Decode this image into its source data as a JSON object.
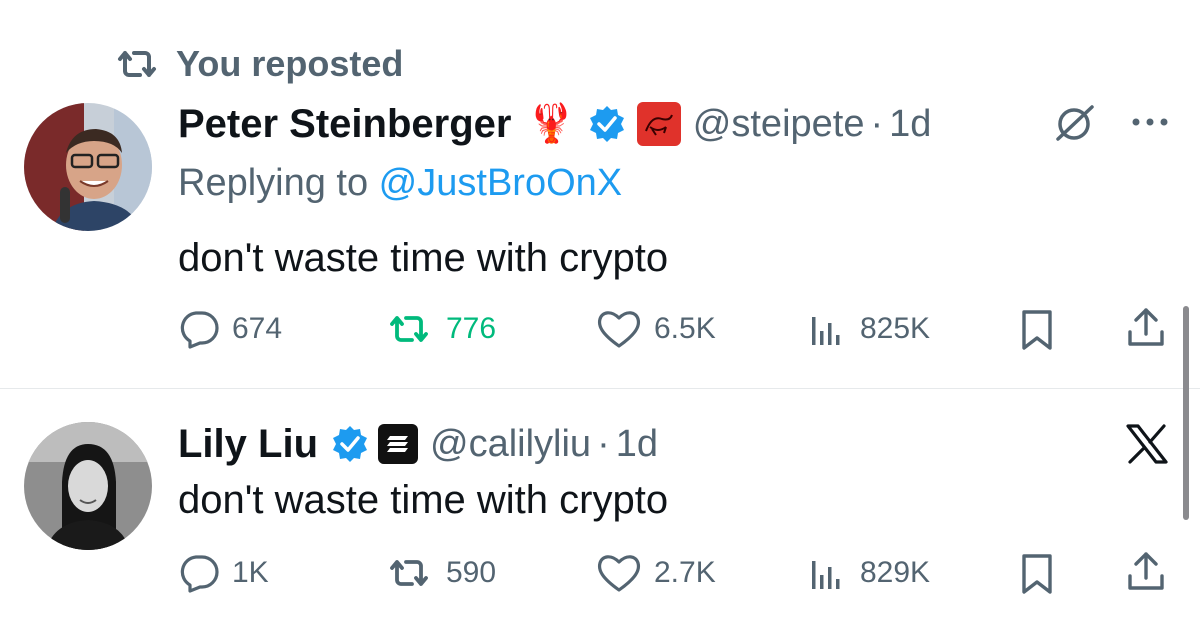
{
  "repost_header": {
    "label": "You reposted"
  },
  "tweets": [
    {
      "name": "Peter Steinberger",
      "handle": "@steipete",
      "separator": "·",
      "time": "1d",
      "replying_prefix": "Replying to ",
      "replying_handle": "@JustBroOnX",
      "text": "don't waste time with crypto",
      "actions": {
        "replies": "674",
        "reposts": "776",
        "likes": "6.5K",
        "views": "825K"
      }
    },
    {
      "name": "Lily Liu",
      "handle": "@calilyliu",
      "separator": "·",
      "time": "1d",
      "text": "don't waste time with crypto",
      "actions": {
        "replies": "1K",
        "reposts": "590",
        "likes": "2.7K",
        "views": "829K"
      }
    }
  ],
  "colors": {
    "muted": "#536471",
    "accent_blue": "#1d9bf0",
    "repost_green": "#00ba7c",
    "verified_blue": "#1d9bf0"
  }
}
